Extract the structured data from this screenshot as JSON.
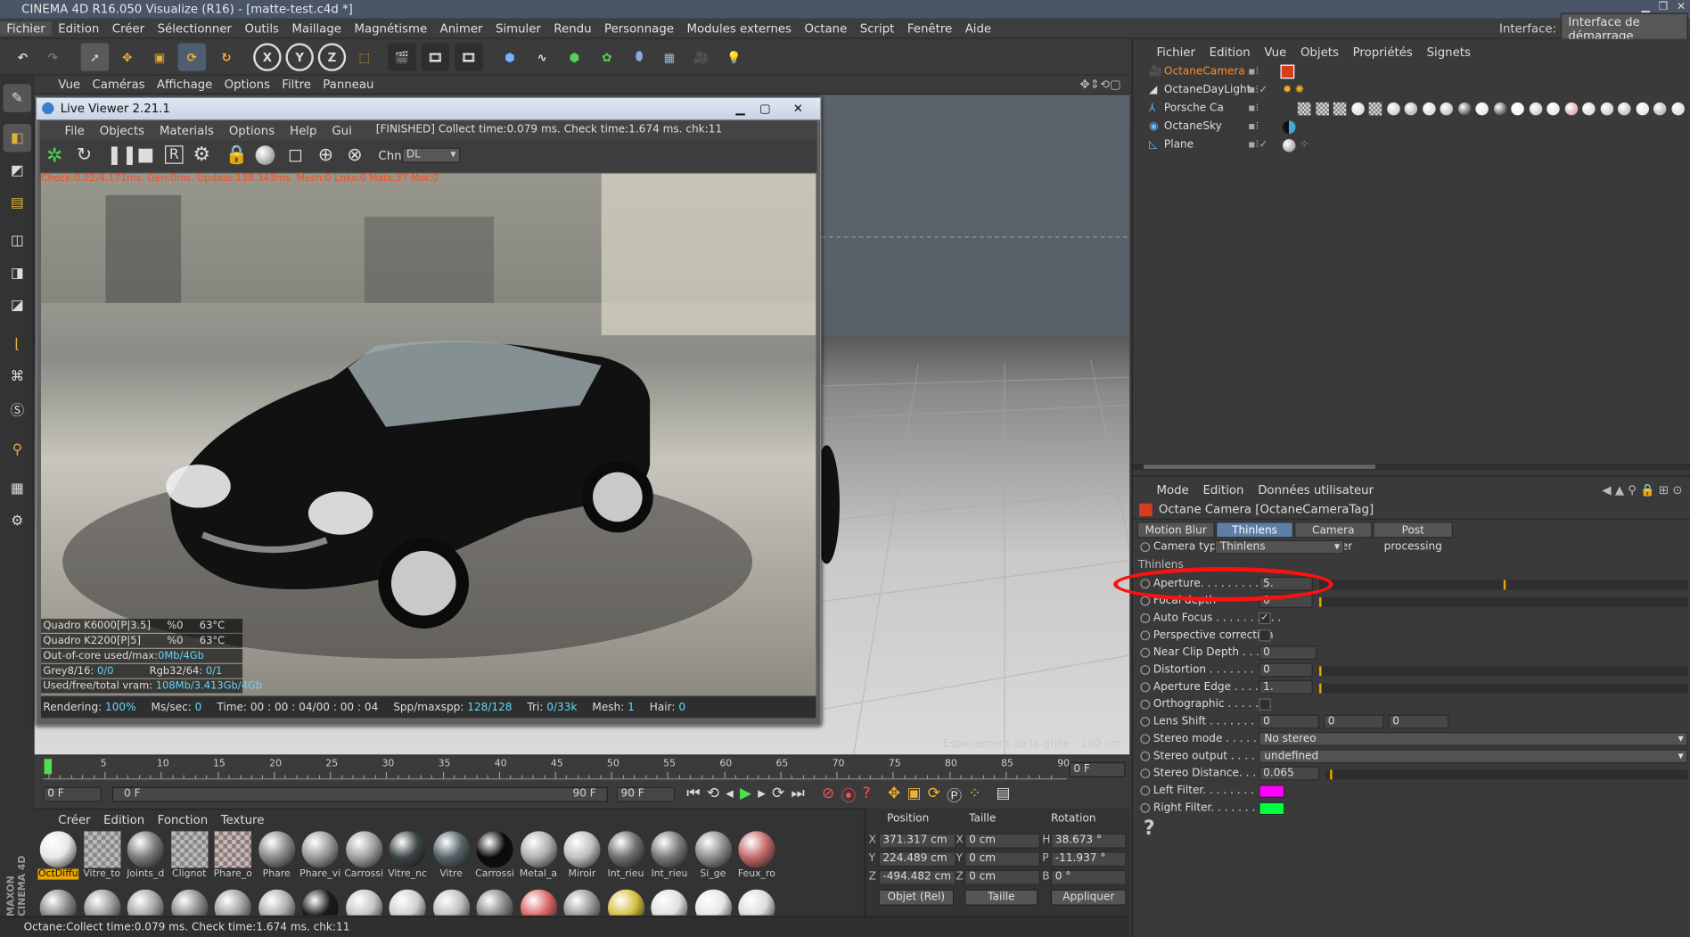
{
  "app": {
    "title": "CINEMA 4D R16.050 Visualize (R16) - [matte-test.c4d *]",
    "menu": [
      "Fichier",
      "Edition",
      "Créer",
      "Sélectionner",
      "Outils",
      "Maillage",
      "Magnétisme",
      "Animer",
      "Simuler",
      "Rendu",
      "Personnage",
      "Modules externes",
      "Octane",
      "Script",
      "Fenêtre",
      "Aide"
    ],
    "interface_label": "Interface:",
    "interface_value": "Interface de démarrage"
  },
  "viewport": {
    "menu": [
      "Vue",
      "Caméras",
      "Affichage",
      "Options",
      "Filtre",
      "Panneau"
    ],
    "grid_label": "Espacement de la grille : 100 cm"
  },
  "live_viewer": {
    "title": "Live Viewer 2.21.1",
    "menu": [
      "File",
      "Objects",
      "Materials",
      "Options",
      "Help",
      "Gui"
    ],
    "status": "[FINISHED] Collect time:0.079 ms.  Check time:1.674 ms.  chk:11",
    "channel_label": "Chn:",
    "channel_value": "DL",
    "render_info": "Check:0.22/4.171ms. Gen:0ms. Update:138.343ms. Mesh:0 Lnks:0 Mats:37 Mot:0",
    "stats": [
      {
        "a": "Quadro K6000[P|3.5]",
        "b": "%0",
        "c": "63°C"
      },
      {
        "a": "Quadro K2200[P|5]",
        "b": "%0",
        "c": "63°C"
      }
    ],
    "outofcore_label": "Out-of-core used/max:",
    "outofcore_value": "0Mb/4Gb",
    "grey_label": "Grey8/16:",
    "grey_value": "0/0",
    "rgb_label": "Rgb32/64:",
    "rgb_value": "0/1",
    "vram_label": "Used/free/total vram:",
    "vram_value": "108Mb/3.413Gb/4Gb",
    "footer": {
      "rendering_label": "Rendering:",
      "rendering_value": "100%",
      "mssec_label": "Ms/sec:",
      "mssec_value": "0",
      "time_label": "Time:",
      "time_value": "00 : 00 : 04/00 : 00 : 04",
      "spp_label": "Spp/maxspp:",
      "spp_value": "128/128",
      "tri_label": "Tri:",
      "tri_value": "0/33k",
      "mesh_label": "Mesh:",
      "mesh_value": "1",
      "hair_label": "Hair:",
      "hair_value": "0"
    }
  },
  "timeline": {
    "ticks": [
      "0",
      "5",
      "10",
      "15",
      "20",
      "25",
      "30",
      "35",
      "40",
      "45",
      "50",
      "55",
      "60",
      "65",
      "70",
      "75",
      "80",
      "85",
      "90"
    ],
    "current_frame": "0 F",
    "start": "0 F",
    "range_start": "0 F",
    "range_end": "90 F",
    "end": "90 F"
  },
  "materials": {
    "menu": [
      "Créer",
      "Edition",
      "Fonction",
      "Texture"
    ],
    "row1": [
      {
        "name": "OctDiffu",
        "color": "#e8e8e8"
      },
      {
        "name": "Vitre_to",
        "color": "checker"
      },
      {
        "name": "Joints_d",
        "color": "#7a7a7a"
      },
      {
        "name": "Clignot",
        "color": "checker"
      },
      {
        "name": "Phare_o",
        "color": "checker2"
      },
      {
        "name": "Phare",
        "color": "#8a8a8a"
      },
      {
        "name": "Phare_vi",
        "color": "#9a9a9a"
      },
      {
        "name": "Carrossi",
        "color": "#a0a0a0"
      },
      {
        "name": "Vitre_nc",
        "color": "#3c4446"
      },
      {
        "name": "Vitre",
        "color": "#56656a"
      },
      {
        "name": "Carrossi",
        "color": "#0a0a0a"
      },
      {
        "name": "Metal_a",
        "color": "#b0b0b0"
      },
      {
        "name": "Miroir",
        "color": "#c0c0c0"
      },
      {
        "name": "Int_rieu",
        "color": "#6e6e6e"
      },
      {
        "name": "Int_rieu",
        "color": "#7a7a7a"
      },
      {
        "name": "Si_ge",
        "color": "#8e8e8e"
      },
      {
        "name": "Feux_ro",
        "color": "#c46a6a"
      }
    ],
    "row2": [
      "#8a8a8a",
      "#9a9a9a",
      "#a5a5a5",
      "#8c8c8c",
      "#a0a0a0",
      "#b0b0b0",
      "#1a1a1a",
      "#c5c5c5",
      "#d0d0d0",
      "#bfbfbf",
      "#888",
      "#d66",
      "#999",
      "#d4c040",
      "#e0e0e0",
      "#e6e6e6",
      "#dcdcdc"
    ]
  },
  "coords": {
    "headers": [
      "Position",
      "Taille",
      "Rotation"
    ],
    "rows": [
      {
        "a": "X",
        "pos": "371.317 cm",
        "b": "X",
        "size": "0 cm",
        "c": "H",
        "rot": "38.673 °"
      },
      {
        "a": "Y",
        "pos": "224.489 cm",
        "b": "Y",
        "size": "0 cm",
        "c": "P",
        "rot": "-11.937 °"
      },
      {
        "a": "Z",
        "pos": "-494.482 cm",
        "b": "Z",
        "size": "0 cm",
        "c": "B",
        "rot": "0 °"
      }
    ],
    "mode": "Objet (Rel)",
    "size_mode": "Taille",
    "apply": "Appliquer"
  },
  "statusbar": "Octane:Collect time:0.079 ms.  Check time:1.674 ms.  chk:11",
  "maxon": "MAXON CINEMA 4D",
  "objects": {
    "menu": [
      "Fichier",
      "Edition",
      "Vue",
      "Objets",
      "Propriétés",
      "Signets"
    ],
    "items": [
      "OctaneCamera",
      "OctaneDayLight",
      "Porsche Ca",
      "OctaneSky",
      "Plane"
    ]
  },
  "attributes": {
    "menu": [
      "Mode",
      "Edition",
      "Données utilisateur"
    ],
    "header": "Octane Camera [OctaneCameraTag]",
    "tabs": [
      "Motion Blur",
      "Thinlens",
      "Camera Imager",
      "Post processing"
    ],
    "camera_type_label": "Camera type",
    "camera_type_value": "Thinlens",
    "section": "Thinlens",
    "aperture_label": "Aperture. . . . . . . . . . . .",
    "aperture_value": "5.",
    "aperture_fraction": 0.5,
    "focal_label": "Focal depth",
    "focal_value": "0",
    "autofocus_label": "Auto Focus . . . . . . . . . .",
    "autofocus_check": "✓",
    "perspective_label": "Perspective correction",
    "nearclip_label": "Near Clip Depth . . . .",
    "nearclip_value": "0",
    "distortion_label": "Distortion . . . . . . . . . .",
    "distortion_value": "0",
    "apedge_label": "Aperture Edge . . . . . .",
    "apedge_value": "1.",
    "ortho_label": "Orthographic . . . . . . .",
    "lensshift_label": "Lens Shift . . . . . . . . . .",
    "lensshift_values": [
      "0",
      "0",
      "0"
    ],
    "stereomode_label": "Stereo mode . . . . . . .",
    "stereomode_value": "No stereo",
    "stereooutput_label": "Stereo output . . . . . .",
    "stereooutput_value": "undefined",
    "stereodist_label": "Stereo Distance. . . . .",
    "stereodist_value": "0.065",
    "leftfilter_label": "Left Filter. . . . . . . . . .",
    "leftfilter_color": "#ff00ff",
    "rightfilter_label": "Right Filter. . . . . . . . .",
    "rightfilter_color": "#00ff40",
    "help": "?"
  }
}
